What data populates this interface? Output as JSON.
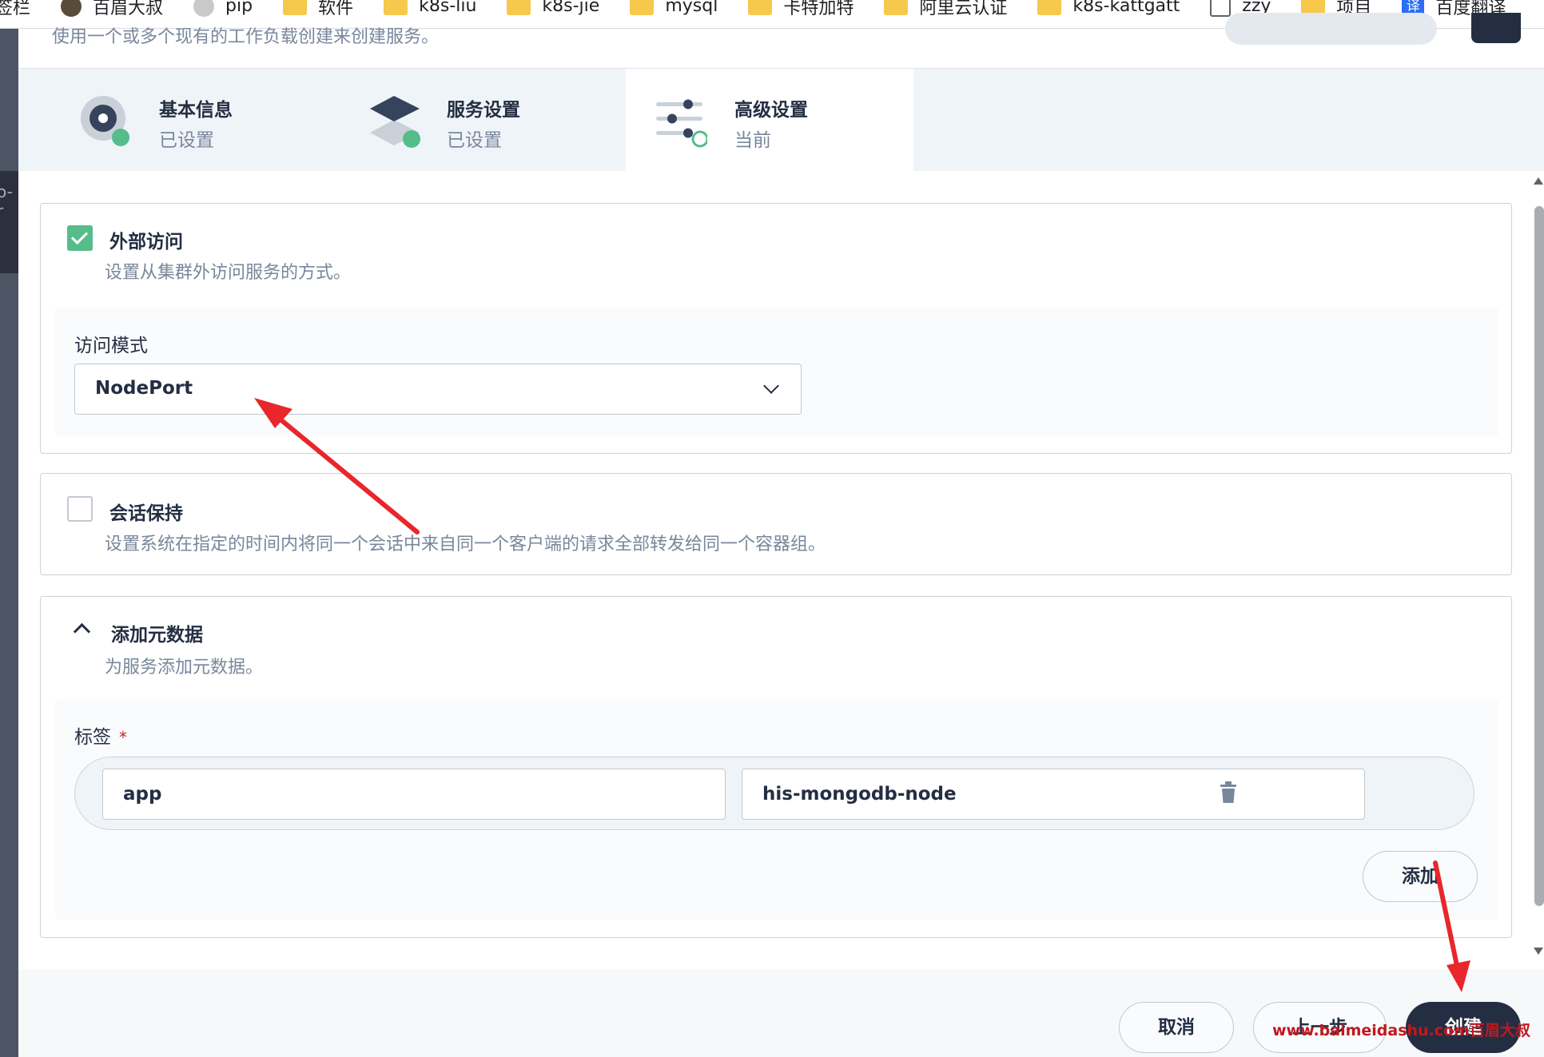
{
  "bookmarks": [
    {
      "label": "签栏",
      "icon": "none"
    },
    {
      "label": "百眉大叔",
      "icon": "person-avatar-icon"
    },
    {
      "label": "pip",
      "icon": "avatar-icon"
    },
    {
      "label": "软件",
      "icon": "folder-icon"
    },
    {
      "label": "k8s-liu",
      "icon": "folder-icon"
    },
    {
      "label": "k8s-jie",
      "icon": "folder-icon"
    },
    {
      "label": "mysql",
      "icon": "folder-icon"
    },
    {
      "label": "卡特加特",
      "icon": "folder-icon"
    },
    {
      "label": "阿里云认证",
      "icon": "folder-icon"
    },
    {
      "label": "k8s-kattgatt",
      "icon": "folder-icon"
    },
    {
      "label": "zzy",
      "icon": "document-icon"
    },
    {
      "label": "项目",
      "icon": "folder-icon"
    },
    {
      "label": "百度翻译",
      "icon": "translate-icon"
    }
  ],
  "sidebar_fragment": "o-r",
  "modal": {
    "description": "使用一个或多个现有的工作负载创建来创建服务。"
  },
  "steps": [
    {
      "title": "基本信息",
      "status": "已设置"
    },
    {
      "title": "服务设置",
      "status": "已设置"
    },
    {
      "title": "高级设置",
      "status": "当前"
    }
  ],
  "external_access": {
    "title": "外部访问",
    "description": "设置从集群外访问服务的方式。",
    "checked": true,
    "mode_label": "访问模式",
    "mode_value": "NodePort"
  },
  "session_affinity": {
    "title": "会话保持",
    "description": "设置系统在指定的时间内将同一个会话中来自同一个客户端的请求全部转发给同一个容器组。",
    "checked": false
  },
  "metadata": {
    "title": "添加元数据",
    "description": "为服务添加元数据。",
    "labels_label": "标签",
    "required_mark": "*",
    "label_key": "app",
    "label_value": "his-mongodb-node",
    "add_button": "添加"
  },
  "footer": {
    "cancel": "取消",
    "previous": "上一步",
    "create": "创建"
  },
  "watermark": "www.baimeidashu.com百眉大叔",
  "colors": {
    "primary_dark": "#242e42",
    "success_green": "#55bc8a",
    "muted_text": "#79879c",
    "annotation_red": "#e8262b"
  }
}
